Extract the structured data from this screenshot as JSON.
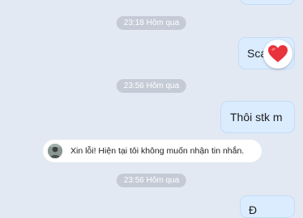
{
  "messages": {
    "top_text": "",
    "sca_text": "Sca",
    "thoi_text": "Thôi stk m",
    "bottom_text": "Đ"
  },
  "times": {
    "t1": "23:18 Hôm qua",
    "t2": "23:56 Hôm qua",
    "t3": "23:56 Hôm qua"
  },
  "notice": {
    "text": "Xin lỗi! Hiện tại tôi không muốn nhận tin nhắn."
  },
  "reaction": {
    "icon": "heart-icon",
    "color": "#e8323c"
  },
  "colors": {
    "background": "#e2e9f3",
    "bubble_out": "#dbecff",
    "time_pill": "#c4cbd6"
  }
}
